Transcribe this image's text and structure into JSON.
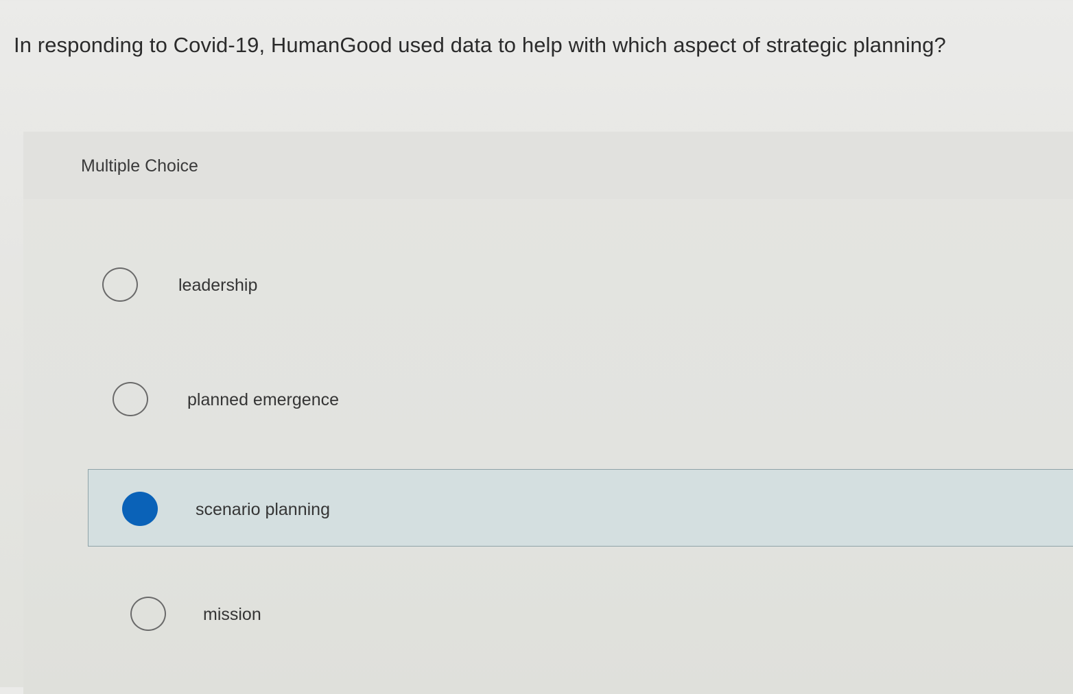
{
  "question": {
    "text": "In responding to Covid-19, HumanGood used data to help with which aspect of strategic planning?"
  },
  "answer_panel": {
    "type_label": "Multiple Choice",
    "options": [
      {
        "label": "leadership",
        "selected": false
      },
      {
        "label": "planned emergence",
        "selected": false
      },
      {
        "label": "scenario planning",
        "selected": true
      },
      {
        "label": "mission",
        "selected": false
      }
    ],
    "colors": {
      "selected_radio": "#0a62b8",
      "selected_background": "#d4dfe0"
    }
  }
}
